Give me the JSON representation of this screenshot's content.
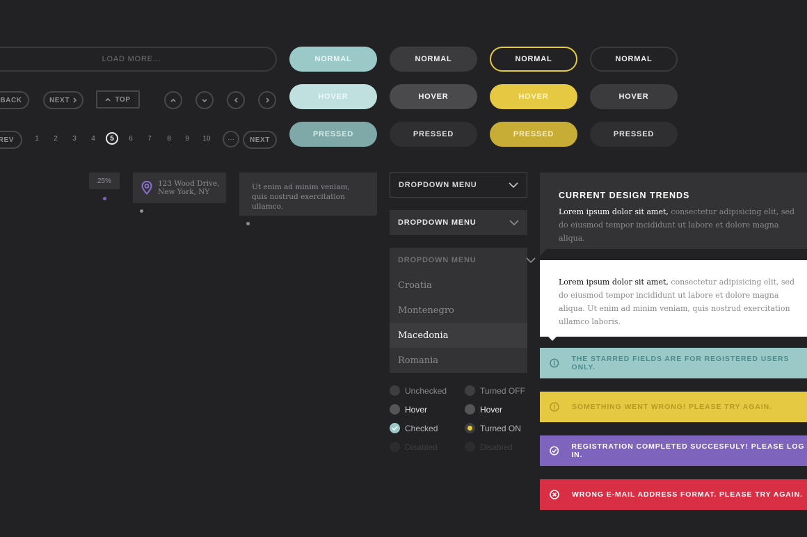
{
  "load_more": "LOAD MORE...",
  "button_grid": {
    "teal": [
      "NORMAL",
      "HOVER",
      "PRESSED"
    ],
    "dark": [
      "NORMAL",
      "HOVER",
      "PRESSED"
    ],
    "yellow": [
      "NORMAL",
      "HOVER",
      "PRESSED"
    ],
    "outline": [
      "NORMAL",
      "HOVER",
      "PRESSED"
    ]
  },
  "nav": {
    "back": "BACK",
    "next": "NEXT",
    "top": "TOP"
  },
  "pagination": {
    "prev": "PREV",
    "pages": [
      "1",
      "2",
      "3",
      "4",
      "5",
      "6",
      "7",
      "8",
      "9",
      "10"
    ],
    "current": "5",
    "ellipsis": "···",
    "next": "NEXT"
  },
  "tooltips": {
    "percent": "25%",
    "address_line1": "123 Wood Drive,",
    "address_line2": "New York, NY",
    "quote": "Ut enim ad minim veniam, quis nostrud exercitation ullamco."
  },
  "dropdowns": {
    "label1": "DROPDOWN MENU",
    "label2": "DROPDOWN MENU",
    "label3": "DROPDOWN MENU",
    "options": [
      "Croatia",
      "Montenegro",
      "Macedonia",
      "Romania"
    ],
    "selected": "Macedonia"
  },
  "radios": {
    "left": [
      "Unchecked",
      "Hover",
      "Checked",
      "Disabled"
    ],
    "right": [
      "Turned OFF",
      "Hover",
      "Turned ON",
      "Disabled"
    ]
  },
  "cards": {
    "trend_title": "CURRENT DESIGN TRENDS",
    "trend_lead": "Lorem ipsum dolor sit amet,",
    "trend_rest": " consectetur adipisicing elit, sed do eiusmod tempor incididunt ut labore et dolore magna aliqua.",
    "white_lead": "Lorem ipsum dolor sit amet,",
    "white_rest": " consectetur adipisicing elit, sed do eiusmod tempor incididunt ut labore et dolore magna aliqua. Ut enim ad minim veniam, quis nostrud exercitation ullamco laboris."
  },
  "alerts": {
    "info": "THE STARRED FIELDS ARE FOR REGISTERED USERS ONLY.",
    "warning": "SOMETHING WENT WRONG! PLEASE TRY AGAIN.",
    "success": "REGISTRATION COMPLETED SUCCESFULY! PLEASE LOG IN.",
    "error": "WRONG E-MAIL ADDRESS FORMAT. PLEASE TRY AGAIN."
  },
  "colors": {
    "background": "#222224",
    "teal": "#9ac9c8",
    "yellow": "#e5c942",
    "purple": "#7e64bd",
    "red": "#d92f45"
  },
  "icons": [
    "chevron-up-icon",
    "chevron-down-icon",
    "chevron-left-icon",
    "chevron-right-icon",
    "location-pin-icon",
    "info-icon",
    "warning-icon",
    "check-circle-icon",
    "close-circle-icon"
  ]
}
